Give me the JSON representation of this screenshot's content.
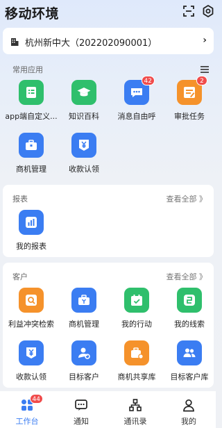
{
  "header": {
    "title": "移动环境",
    "scan_icon": "scan-icon",
    "settings_icon": "settings-icon"
  },
  "org": {
    "name": "杭州新中大（202202090001）",
    "chevron": "›"
  },
  "common": {
    "title": "常用应用",
    "apps": [
      {
        "label": "app端自定义...",
        "color": "#2fbf6c",
        "icon": "form-icon"
      },
      {
        "label": "知识百科",
        "color": "#2fbf6c",
        "icon": "graduation-cap-icon"
      },
      {
        "label": "消息自由呼",
        "color": "#3b7df2",
        "icon": "chat-icon",
        "badge": "42"
      },
      {
        "label": "审批任务",
        "color": "#f5922b",
        "icon": "approval-icon",
        "badge": "2"
      },
      {
        "label": "商机管理",
        "color": "#3b7df2",
        "icon": "briefcase-icon"
      },
      {
        "label": "收款认领",
        "color": "#3b7df2",
        "icon": "payment-claim-icon"
      }
    ]
  },
  "reports": {
    "title": "报表",
    "view_all": "查看全部 》",
    "apps": [
      {
        "label": "我的报表",
        "color": "#3b7df2",
        "icon": "bar-chart-icon"
      }
    ]
  },
  "customers": {
    "title": "客户",
    "view_all": "查看全部 》",
    "apps": [
      {
        "label": "利益冲突检索",
        "color": "#f5922b",
        "icon": "search-doc-icon"
      },
      {
        "label": "商机管理",
        "color": "#3b7df2",
        "icon": "briefcase-icon"
      },
      {
        "label": "我的行动",
        "color": "#2fbf6c",
        "icon": "calendar-check-icon"
      },
      {
        "label": "我的线索",
        "color": "#2fbf6c",
        "icon": "clue-icon"
      },
      {
        "label": "收款认领",
        "color": "#3b7df2",
        "icon": "payment-claim-icon"
      },
      {
        "label": "目标客户",
        "color": "#3b7df2",
        "icon": "target-user-icon"
      },
      {
        "label": "商机共享库",
        "color": "#f5922b",
        "icon": "shared-briefcase-icon"
      },
      {
        "label": "目标客户库",
        "color": "#3b7df2",
        "icon": "user-group-icon"
      }
    ]
  },
  "tabs": [
    {
      "label": "工作台",
      "icon": "workbench-icon",
      "badge": "44",
      "active": true
    },
    {
      "label": "通知",
      "icon": "notice-icon"
    },
    {
      "label": "通讯录",
      "icon": "contacts-icon"
    },
    {
      "label": "我的",
      "icon": "profile-icon"
    }
  ]
}
